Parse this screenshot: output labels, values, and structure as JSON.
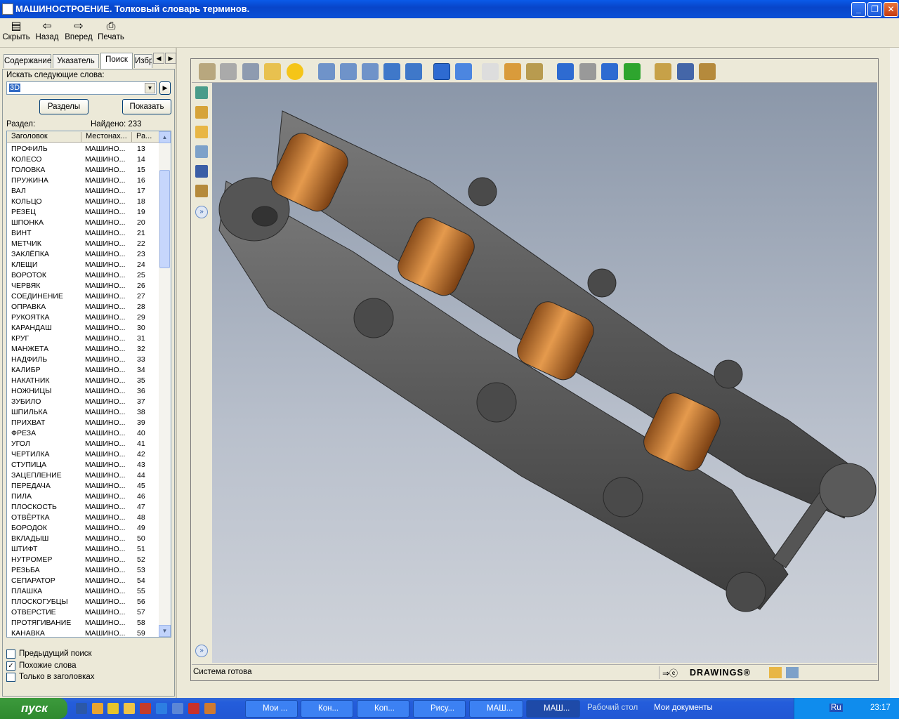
{
  "window": {
    "title": "МАШИНОСТРОЕНИЕ. Толковый словарь терминов."
  },
  "toolbar": {
    "hide": "Скрыть",
    "back": "Назад",
    "forward": "Вперед",
    "print": "Печать"
  },
  "tabs": {
    "contents": "Содержание",
    "index": "Указатель",
    "search": "Поиск",
    "favorites": "Избр"
  },
  "search": {
    "label": "Искать следующие слова:",
    "value": "3D",
    "sections_btn": "Разделы",
    "show_btn": "Показать",
    "section_label": "Раздел:",
    "found": "Найдено: 233"
  },
  "list": {
    "columns": [
      "Заголовок",
      "Местонах...",
      "Ра..."
    ],
    "rows": [
      [
        "ПРОФИЛЬ",
        "МАШИНО...",
        "13"
      ],
      [
        "КОЛЕСО",
        "МАШИНО...",
        "14"
      ],
      [
        "ГОЛОВКА",
        "МАШИНО...",
        "15"
      ],
      [
        "ПРУЖИНА",
        "МАШИНО...",
        "16"
      ],
      [
        "ВАЛ",
        "МАШИНО...",
        "17"
      ],
      [
        "КОЛЬЦО",
        "МАШИНО...",
        "18"
      ],
      [
        "РЕЗЕЦ",
        "МАШИНО...",
        "19"
      ],
      [
        "ШПОНКА",
        "МАШИНО...",
        "20"
      ],
      [
        "ВИНТ",
        "МАШИНО...",
        "21"
      ],
      [
        "МЕТЧИК",
        "МАШИНО...",
        "22"
      ],
      [
        "ЗАКЛЁПКА",
        "МАШИНО...",
        "23"
      ],
      [
        "КЛЕЩИ",
        "МАШИНО...",
        "24"
      ],
      [
        "ВОРОТОК",
        "МАШИНО...",
        "25"
      ],
      [
        "ЧЕРВЯК",
        "МАШИНО...",
        "26"
      ],
      [
        "СОЕДИНЕНИЕ",
        "МАШИНО...",
        "27"
      ],
      [
        "ОПРАВКА",
        "МАШИНО...",
        "28"
      ],
      [
        "РУКОЯТКА",
        "МАШИНО...",
        "29"
      ],
      [
        "КАРАНДАШ",
        "МАШИНО...",
        "30"
      ],
      [
        "КРУГ",
        "МАШИНО...",
        "31"
      ],
      [
        "МАНЖЕТА",
        "МАШИНО...",
        "32"
      ],
      [
        "НАДФИЛЬ",
        "МАШИНО...",
        "33"
      ],
      [
        "КАЛИБР",
        "МАШИНО...",
        "34"
      ],
      [
        "НАКАТНИК",
        "МАШИНО...",
        "35"
      ],
      [
        "НОЖНИЦЫ",
        "МАШИНО...",
        "36"
      ],
      [
        "ЗУБИЛО",
        "МАШИНО...",
        "37"
      ],
      [
        "ШПИЛЬКА",
        "МАШИНО...",
        "38"
      ],
      [
        "ПРИХВАТ",
        "МАШИНО...",
        "39"
      ],
      [
        "ФРЕЗА",
        "МАШИНО...",
        "40"
      ],
      [
        "УГОЛ",
        "МАШИНО...",
        "41"
      ],
      [
        "ЧЕРТИЛКА",
        "МАШИНО...",
        "42"
      ],
      [
        "СТУПИЦА",
        "МАШИНО...",
        "43"
      ],
      [
        "ЗАЦЕПЛЕНИЕ",
        "МАШИНО...",
        "44"
      ],
      [
        "ПЕРЕДАЧА",
        "МАШИНО...",
        "45"
      ],
      [
        "ПИЛА",
        "МАШИНО...",
        "46"
      ],
      [
        "ПЛОСКОСТЬ",
        "МАШИНО...",
        "47"
      ],
      [
        "ОТВЁРТКА",
        "МАШИНО...",
        "48"
      ],
      [
        "БОРОДОК",
        "МАШИНО...",
        "49"
      ],
      [
        "ВКЛАДЫШ",
        "МАШИНО...",
        "50"
      ],
      [
        "ШТИФТ",
        "МАШИНО...",
        "51"
      ],
      [
        "НУТРОМЕР",
        "МАШИНО...",
        "52"
      ],
      [
        "РЕЗЬБА",
        "МАШИНО...",
        "53"
      ],
      [
        "СЕПАРАТОР",
        "МАШИНО...",
        "54"
      ],
      [
        "ПЛАШКА",
        "МАШИНО...",
        "55"
      ],
      [
        "ПЛОСКОГУБЦЫ",
        "МАШИНО...",
        "56"
      ],
      [
        "ОТВЕРСТИЕ",
        "МАШИНО...",
        "57"
      ],
      [
        "ПРОТЯГИВАНИЕ",
        "МАШИНО...",
        "58"
      ],
      [
        "КАНАВКА",
        "МАШИНО...",
        "59"
      ]
    ]
  },
  "options": {
    "prev_search": "Предыдущий поиск",
    "similar": "Похожие слова",
    "titles_only": "Только в заголовках"
  },
  "viewer": {
    "status": "Система готова",
    "brand": "DRAWINGS®"
  },
  "taskbar": {
    "start": "пуск",
    "tasks": [
      "Мои ...",
      "Кон...",
      "Коп...",
      "Рису...",
      "МАШ...",
      "МАШ..."
    ],
    "desktop": "Рабочий стол",
    "my_docs": "Мои документы",
    "lang": "RU",
    "lang2": "Ru",
    "time": "23:17"
  }
}
